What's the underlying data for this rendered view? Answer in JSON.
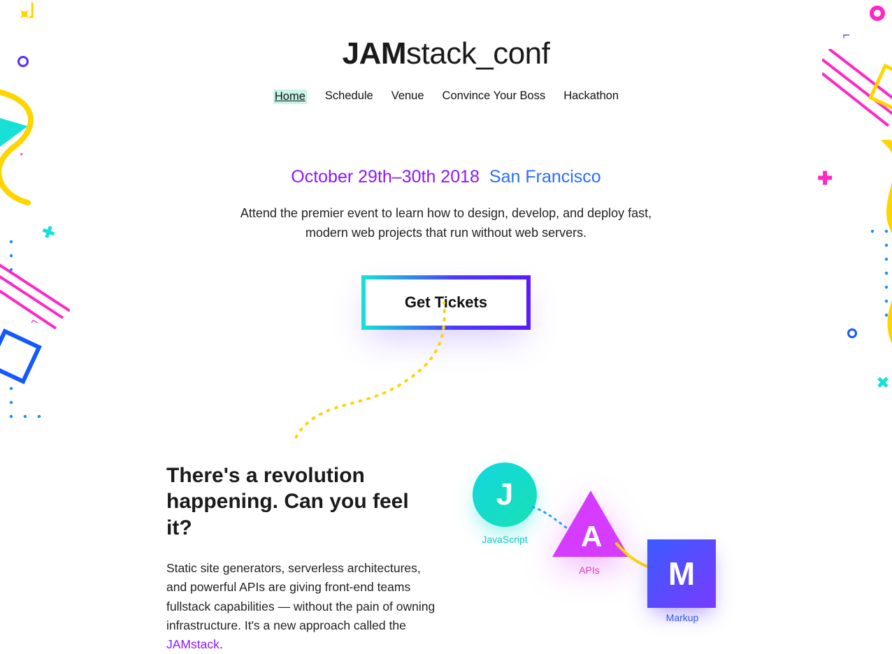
{
  "logo": {
    "bold": "JAM",
    "light": "stack_conf"
  },
  "nav": {
    "home": "Home",
    "schedule": "Schedule",
    "venue": "Venue",
    "convince": "Convince Your Boss",
    "hackathon": "Hackathon"
  },
  "hero": {
    "date": "October 29th–30th 2018",
    "location": "San Francisco",
    "blurb": "Attend the premier event to learn how to design, develop, and deploy fast, modern web projects that run without web servers.",
    "cta": "Get Tickets"
  },
  "section": {
    "heading": "There's a revolution happening. Can you feel it?",
    "body_pre": "Static site generators, serverless architectures, and powerful APIs are giving front-end teams fullstack capabilities — without the pain of owning infrastructure. It's a new approach called the ",
    "body_link": "JAMstack",
    "body_post": "."
  },
  "jam": {
    "j_letter": "J",
    "j_label": "JavaScript",
    "a_letter": "A",
    "a_label": "APIs",
    "m_letter": "M",
    "m_label": "Markup"
  }
}
